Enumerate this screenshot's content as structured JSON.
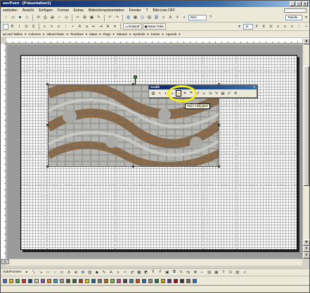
{
  "window": {
    "title": "werPoint - [Präsentation1]",
    "controls": [
      "_",
      "□",
      "×"
    ]
  },
  "menu": {
    "items": [
      "earbeiten",
      "Ansicht",
      "Einfügen",
      "Format",
      "Extras",
      "Bildschirmpräsentation",
      "Fenster",
      "?",
      "Bild-Lists OFF"
    ]
  },
  "toolbar": {
    "zoom": "86%",
    "design_label": "Entwurf",
    "new_slide_label": "Neue Folie",
    "font_size": "11",
    "tabelle_label": "Tabelle",
    "addin_items": [
      "ad and Tables",
      "Columns",
      "ValueChains",
      "Timelines",
      "Maps",
      "Flags",
      "Stamps",
      "Symbols",
      "Extras",
      "Agenda"
    ]
  },
  "picture_toolbar": {
    "title": "Grafik",
    "close": "×",
    "tooltip": "Mehr Helligkeit"
  },
  "draw_toolbar": {
    "autoshapes_label": "AutoFormen"
  },
  "colors": {
    "swatches": [
      "#3b6fc9",
      "#f1b000",
      "#3aa14a",
      "#e0231b",
      "#1a3e8a",
      "#c7c7c7",
      "#7a4fb5",
      "#dd7a16",
      "#1f9fc9",
      "#999999",
      "#4d4d4d",
      "#2d6a2d",
      "#a83232",
      "#e3c800",
      "#0b5fa5",
      "#707070",
      "#b36b00",
      "#6bb34d",
      "#c43e8c",
      "#444444",
      "#2a7f9e",
      "#d14a00",
      "#2f5fb0",
      "#8a8a8a",
      "#0d7c3f",
      "#c9a200",
      "#5a2e91",
      "#b00000",
      "#2f2f2f",
      "#6c6c6c",
      "#1b6fd1"
    ]
  }
}
